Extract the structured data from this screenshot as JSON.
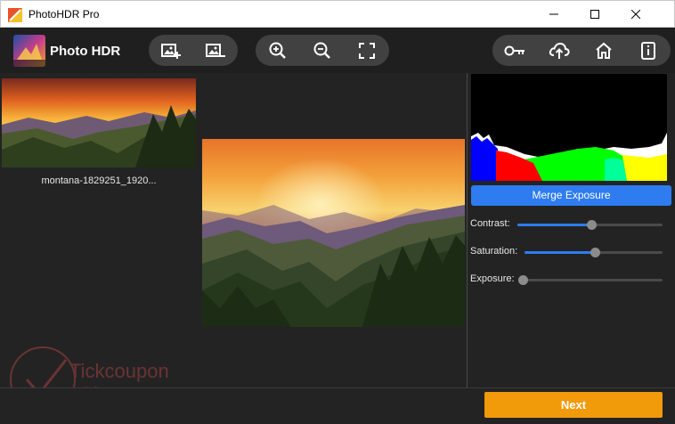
{
  "window": {
    "title": "PhotoHDR Pro"
  },
  "toolbar": {
    "brand": "Photo HDR",
    "logo_text": "PHOTO HDR",
    "buttons_left": [
      {
        "icon": "add-image-icon"
      },
      {
        "icon": "remove-image-icon"
      }
    ],
    "buttons_zoom": [
      {
        "icon": "zoom-in-icon"
      },
      {
        "icon": "zoom-out-icon"
      },
      {
        "icon": "fit-screen-icon"
      }
    ],
    "buttons_right": [
      {
        "icon": "key-icon"
      },
      {
        "icon": "upload-cloud-icon"
      },
      {
        "icon": "home-icon"
      },
      {
        "icon": "info-icon"
      }
    ]
  },
  "thumbnails": [
    {
      "filename": "montana-1829251_1920..."
    }
  ],
  "histogram": {
    "colors": [
      "#0000ff",
      "#ff00ff",
      "#ff0000",
      "#00ff00",
      "#ffff00",
      "#ffffff"
    ]
  },
  "controls": {
    "merge_label": "Merge Exposure",
    "sliders": [
      {
        "label": "Contrast:",
        "value": 0.51
      },
      {
        "label": "Saturation:",
        "value": 0.51
      },
      {
        "label": "Exposure:",
        "value": 0.0
      }
    ]
  },
  "footer": {
    "next_label": "Next"
  },
  "watermark": {
    "line1": "Tickcoupon",
    "line2": "Giveaway"
  },
  "colors": {
    "accent": "#2e7cf0",
    "next": "#f19a0a",
    "background": "#232324"
  }
}
